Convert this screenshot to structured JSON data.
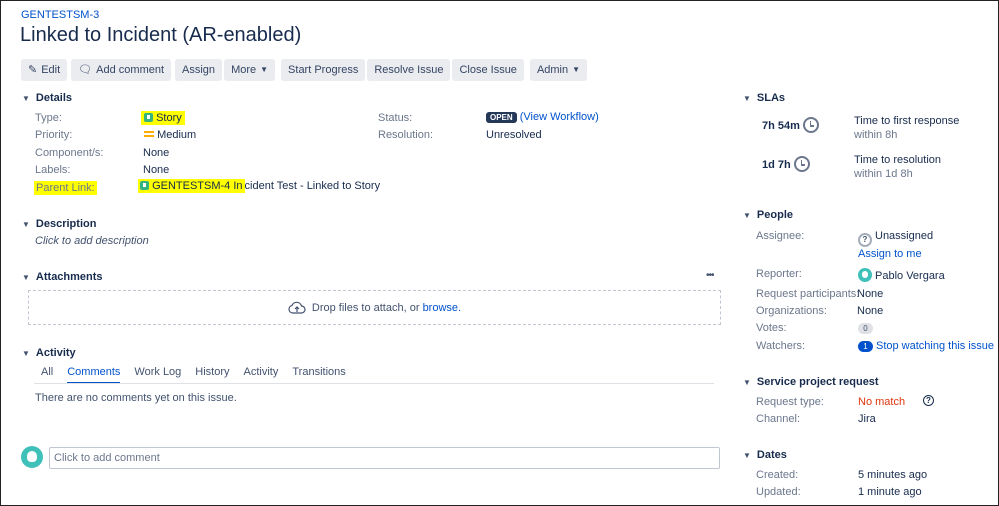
{
  "issue": {
    "key": "GENTESTSM-3",
    "title": "Linked to Incident (AR-enabled)"
  },
  "toolbar": {
    "edit": "Edit",
    "add_comment": "Add comment",
    "assign": "Assign",
    "more": "More",
    "start_progress": "Start Progress",
    "resolve_issue": "Resolve Issue",
    "close_issue": "Close Issue",
    "admin": "Admin"
  },
  "details": {
    "heading": "Details",
    "type_label": "Type:",
    "type_value": "Story",
    "priority_label": "Priority:",
    "priority_value": "Medium",
    "components_label": "Component/s:",
    "components_value": "None",
    "labels_label": "Labels:",
    "labels_value": "None",
    "parent_label": "Parent Link:",
    "parent_key": "GENTESTSM-4",
    "parent_highlight_tail": " In",
    "parent_rest": "cident Test - Linked to Story",
    "status_label": "Status:",
    "status_value": "OPEN",
    "view_workflow": "(View Workflow)",
    "resolution_label": "Resolution:",
    "resolution_value": "Unresolved"
  },
  "description": {
    "heading": "Description",
    "placeholder": "Click to add description"
  },
  "attachments": {
    "heading": "Attachments",
    "more": "•••",
    "drop_text": "Drop files to attach, or ",
    "browse": "browse."
  },
  "activity": {
    "heading": "Activity",
    "tabs": [
      "All",
      "Comments",
      "Work Log",
      "History",
      "Activity",
      "Transitions"
    ],
    "empty": "There are no comments yet on this issue.",
    "comment_placeholder": "Click to add comment"
  },
  "slas": {
    "heading": "SLAs",
    "items": [
      {
        "time": "7h 54m",
        "name": "Time to first response",
        "goal": "within 8h"
      },
      {
        "time": "1d 7h",
        "name": "Time to resolution",
        "goal": "within 1d 8h"
      }
    ]
  },
  "people": {
    "heading": "People",
    "assignee_label": "Assignee:",
    "assignee_value": "Unassigned",
    "assign_to_me": "Assign to me",
    "reporter_label": "Reporter:",
    "reporter_value": "Pablo Vergara",
    "participants_label": "Request participants:",
    "participants_value": "None",
    "organizations_label": "Organizations:",
    "organizations_value": "None",
    "votes_label": "Votes:",
    "votes_value": "0",
    "watchers_label": "Watchers:",
    "watchers_count": "1",
    "watchers_action": "Stop watching this issue"
  },
  "service": {
    "heading": "Service project request",
    "request_type_label": "Request type:",
    "request_type_value": "No match",
    "channel_label": "Channel:",
    "channel_value": "Jira"
  },
  "dates": {
    "heading": "Dates",
    "created_label": "Created:",
    "created_value": "5 minutes ago",
    "updated_label": "Updated:",
    "updated_value": "1 minute ago"
  },
  "colors": {
    "link": "#0052cc",
    "highlight": "#ffff00",
    "story_green": "#36b37e",
    "medium_priority": "#ffab00",
    "no_match_red": "#de350b"
  }
}
